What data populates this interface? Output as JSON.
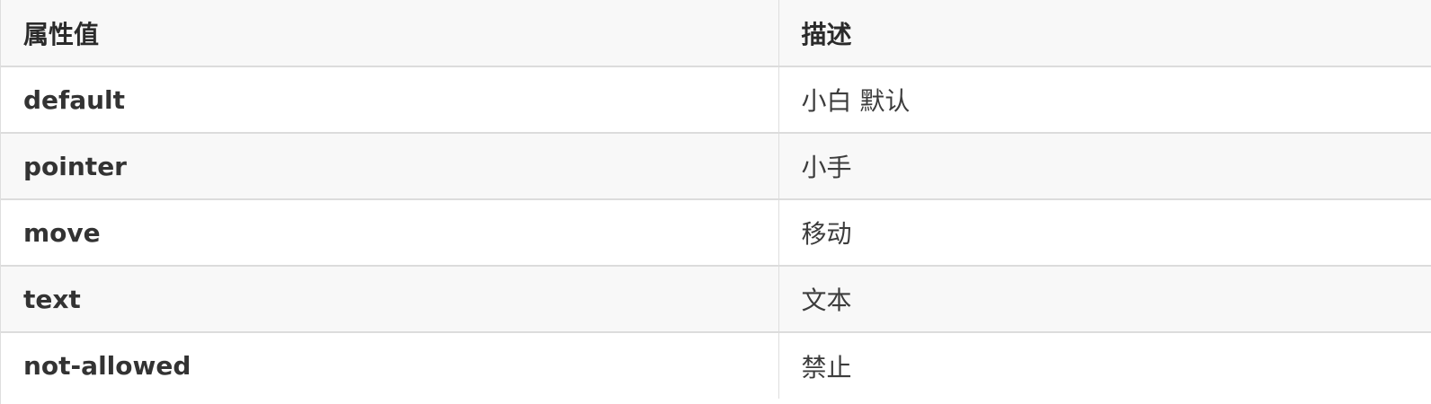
{
  "table": {
    "headers": [
      "属性值",
      "描述"
    ],
    "rows": [
      {
        "value": "default",
        "desc": "小白 默认"
      },
      {
        "value": "pointer",
        "desc": "小手"
      },
      {
        "value": "move",
        "desc": "移动"
      },
      {
        "value": "text",
        "desc": "文本"
      },
      {
        "value": "not-allowed",
        "desc": "禁止"
      }
    ]
  }
}
